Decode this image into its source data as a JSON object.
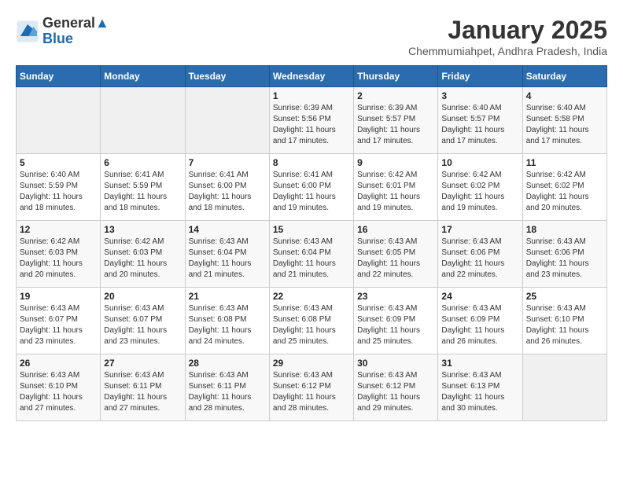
{
  "header": {
    "logo_line1": "General",
    "logo_line2": "Blue",
    "month": "January 2025",
    "location": "Chemmumiahpet, Andhra Pradesh, India"
  },
  "days_of_week": [
    "Sunday",
    "Monday",
    "Tuesday",
    "Wednesday",
    "Thursday",
    "Friday",
    "Saturday"
  ],
  "weeks": [
    [
      {
        "day": "",
        "info": ""
      },
      {
        "day": "",
        "info": ""
      },
      {
        "day": "",
        "info": ""
      },
      {
        "day": "1",
        "info": "Sunrise: 6:39 AM\nSunset: 5:56 PM\nDaylight: 11 hours and 17 minutes."
      },
      {
        "day": "2",
        "info": "Sunrise: 6:39 AM\nSunset: 5:57 PM\nDaylight: 11 hours and 17 minutes."
      },
      {
        "day": "3",
        "info": "Sunrise: 6:40 AM\nSunset: 5:57 PM\nDaylight: 11 hours and 17 minutes."
      },
      {
        "day": "4",
        "info": "Sunrise: 6:40 AM\nSunset: 5:58 PM\nDaylight: 11 hours and 17 minutes."
      }
    ],
    [
      {
        "day": "5",
        "info": "Sunrise: 6:40 AM\nSunset: 5:59 PM\nDaylight: 11 hours and 18 minutes."
      },
      {
        "day": "6",
        "info": "Sunrise: 6:41 AM\nSunset: 5:59 PM\nDaylight: 11 hours and 18 minutes."
      },
      {
        "day": "7",
        "info": "Sunrise: 6:41 AM\nSunset: 6:00 PM\nDaylight: 11 hours and 18 minutes."
      },
      {
        "day": "8",
        "info": "Sunrise: 6:41 AM\nSunset: 6:00 PM\nDaylight: 11 hours and 19 minutes."
      },
      {
        "day": "9",
        "info": "Sunrise: 6:42 AM\nSunset: 6:01 PM\nDaylight: 11 hours and 19 minutes."
      },
      {
        "day": "10",
        "info": "Sunrise: 6:42 AM\nSunset: 6:02 PM\nDaylight: 11 hours and 19 minutes."
      },
      {
        "day": "11",
        "info": "Sunrise: 6:42 AM\nSunset: 6:02 PM\nDaylight: 11 hours and 20 minutes."
      }
    ],
    [
      {
        "day": "12",
        "info": "Sunrise: 6:42 AM\nSunset: 6:03 PM\nDaylight: 11 hours and 20 minutes."
      },
      {
        "day": "13",
        "info": "Sunrise: 6:42 AM\nSunset: 6:03 PM\nDaylight: 11 hours and 20 minutes."
      },
      {
        "day": "14",
        "info": "Sunrise: 6:43 AM\nSunset: 6:04 PM\nDaylight: 11 hours and 21 minutes."
      },
      {
        "day": "15",
        "info": "Sunrise: 6:43 AM\nSunset: 6:04 PM\nDaylight: 11 hours and 21 minutes."
      },
      {
        "day": "16",
        "info": "Sunrise: 6:43 AM\nSunset: 6:05 PM\nDaylight: 11 hours and 22 minutes."
      },
      {
        "day": "17",
        "info": "Sunrise: 6:43 AM\nSunset: 6:06 PM\nDaylight: 11 hours and 22 minutes."
      },
      {
        "day": "18",
        "info": "Sunrise: 6:43 AM\nSunset: 6:06 PM\nDaylight: 11 hours and 23 minutes."
      }
    ],
    [
      {
        "day": "19",
        "info": "Sunrise: 6:43 AM\nSunset: 6:07 PM\nDaylight: 11 hours and 23 minutes."
      },
      {
        "day": "20",
        "info": "Sunrise: 6:43 AM\nSunset: 6:07 PM\nDaylight: 11 hours and 23 minutes."
      },
      {
        "day": "21",
        "info": "Sunrise: 6:43 AM\nSunset: 6:08 PM\nDaylight: 11 hours and 24 minutes."
      },
      {
        "day": "22",
        "info": "Sunrise: 6:43 AM\nSunset: 6:08 PM\nDaylight: 11 hours and 25 minutes."
      },
      {
        "day": "23",
        "info": "Sunrise: 6:43 AM\nSunset: 6:09 PM\nDaylight: 11 hours and 25 minutes."
      },
      {
        "day": "24",
        "info": "Sunrise: 6:43 AM\nSunset: 6:09 PM\nDaylight: 11 hours and 26 minutes."
      },
      {
        "day": "25",
        "info": "Sunrise: 6:43 AM\nSunset: 6:10 PM\nDaylight: 11 hours and 26 minutes."
      }
    ],
    [
      {
        "day": "26",
        "info": "Sunrise: 6:43 AM\nSunset: 6:10 PM\nDaylight: 11 hours and 27 minutes."
      },
      {
        "day": "27",
        "info": "Sunrise: 6:43 AM\nSunset: 6:11 PM\nDaylight: 11 hours and 27 minutes."
      },
      {
        "day": "28",
        "info": "Sunrise: 6:43 AM\nSunset: 6:11 PM\nDaylight: 11 hours and 28 minutes."
      },
      {
        "day": "29",
        "info": "Sunrise: 6:43 AM\nSunset: 6:12 PM\nDaylight: 11 hours and 28 minutes."
      },
      {
        "day": "30",
        "info": "Sunrise: 6:43 AM\nSunset: 6:12 PM\nDaylight: 11 hours and 29 minutes."
      },
      {
        "day": "31",
        "info": "Sunrise: 6:43 AM\nSunset: 6:13 PM\nDaylight: 11 hours and 30 minutes."
      },
      {
        "day": "",
        "info": ""
      }
    ]
  ]
}
